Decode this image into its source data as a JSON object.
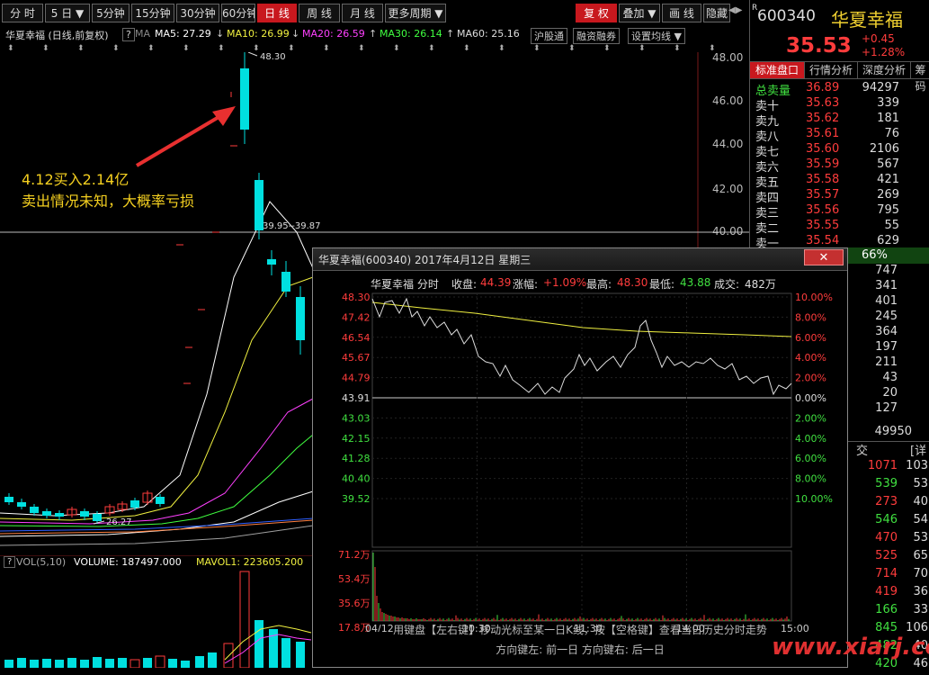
{
  "toolbar": {
    "buttons": [
      {
        "label": "分 时"
      },
      {
        "label": "5 日 ▼"
      },
      {
        "label": "5分钟"
      },
      {
        "label": "15分钟"
      },
      {
        "label": "30分钟"
      },
      {
        "label": "60分钟"
      },
      {
        "label": "日 线"
      },
      {
        "label": "周 线"
      },
      {
        "label": "月 线"
      },
      {
        "label": "更多周期 ▼"
      },
      {
        "label": "复 权"
      },
      {
        "label": "叠加 ▼"
      },
      {
        "label": "画 线"
      },
      {
        "label": "隐藏"
      }
    ],
    "active_index": 6
  },
  "chart_header": {
    "title": "华夏幸福 (日线,前复权)",
    "help": "?",
    "ma_label": "MA",
    "ma5": "MA5: 27.29",
    "ma10": "MA10: 26.99",
    "ma20": "MA20: 26.59",
    "ma30": "MA30: 26.14",
    "ma60": "MA60: 25.16",
    "tag1": "沪股通",
    "tag2": "融资融券",
    "tag3": "设置均线 ▼"
  },
  "colors": {
    "up": "#ff3c3c",
    "down": "#00e0e0",
    "ma5": "#ffffff",
    "ma10": "#f0f040",
    "ma20": "#ff40ff",
    "ma30": "#40ff40",
    "ma60": "#a0a0a0",
    "accent": "#c8181e"
  },
  "main_chart": {
    "y_ticks": [
      "48.00",
      "46.00",
      "44.00",
      "42.00",
      "40.00"
    ],
    "high_label": "48.30",
    "range_label": "39.95--39.87",
    "low_label": "26.27"
  },
  "annotation": {
    "line1": "4.12买入2.14亿",
    "line2": "卖出情况未知，大概率亏损"
  },
  "volume_header": {
    "vol": "VOL(5,10)",
    "volume": "VOLUME: 187497.000",
    "mavol1": "MAVOL1: 223605.200"
  },
  "right_panel": {
    "code": "600340",
    "name": "华夏幸福",
    "price": "35.53",
    "change": "+0.45",
    "change_pct": "+1.28%",
    "tabs": [
      "标准盘口",
      "行情分析",
      "深度分析",
      "筹码"
    ],
    "order_book": [
      {
        "label": "总卖量",
        "price": "36.89",
        "vol": "94297"
      },
      {
        "label": "卖十",
        "price": "35.63",
        "vol": "339"
      },
      {
        "label": "卖九",
        "price": "35.62",
        "vol": "181"
      },
      {
        "label": "卖八",
        "price": "35.61",
        "vol": "76"
      },
      {
        "label": "卖七",
        "price": "35.60",
        "vol": "2106"
      },
      {
        "label": "卖六",
        "price": "35.59",
        "vol": "567"
      },
      {
        "label": "卖五",
        "price": "35.58",
        "vol": "421"
      },
      {
        "label": "卖四",
        "price": "35.57",
        "vol": "269"
      },
      {
        "label": "卖三",
        "price": "35.56",
        "vol": "795"
      },
      {
        "label": "卖二",
        "price": "35.55",
        "vol": "55"
      },
      {
        "label": "卖一",
        "price": "35.54",
        "vol": "629"
      }
    ],
    "ratio": "66%",
    "side_values": [
      "747",
      "341",
      "401",
      "245",
      "364",
      "197",
      "211",
      "43",
      "20",
      "127"
    ],
    "total": "49950",
    "trade_header_left": "交",
    "trade_header_right": "[详",
    "trades": [
      {
        "a": "1071",
        "b": "103",
        "ca": "#ff3c3c"
      },
      {
        "a": "539",
        "b": "53",
        "ca": "#40e040"
      },
      {
        "a": "273",
        "b": "40",
        "ca": "#ff3c3c"
      },
      {
        "a": "546",
        "b": "54",
        "ca": "#40e040"
      },
      {
        "a": "470",
        "b": "53",
        "ca": "#ff3c3c"
      },
      {
        "a": "525",
        "b": "65",
        "ca": "#ff3c3c"
      },
      {
        "a": "714",
        "b": "70",
        "ca": "#ff3c3c"
      },
      {
        "a": "419",
        "b": "36",
        "ca": "#ff3c3c"
      },
      {
        "a": "166",
        "b": "33",
        "ca": "#40e040"
      },
      {
        "a": "845",
        "b": "106",
        "ca": "#40e040"
      },
      {
        "a": "482",
        "b": "40",
        "ca": "#40e040"
      },
      {
        "a": "420",
        "b": "46",
        "ca": "#40e040"
      }
    ]
  },
  "popup": {
    "title": "华夏幸福(600340) 2017年4月12日 星期三",
    "close": "✕",
    "info_name": "华夏幸福 分时",
    "close_label": "收盘:",
    "close_val": "44.39",
    "chg_label": "涨幅:",
    "chg_val": "+1.09%",
    "high_label": "最高:",
    "high_val": "48.30",
    "low_label": "最低:",
    "low_val": "43.88",
    "vol_label": "成交:",
    "vol_val": "482万",
    "price_ticks": [
      "48.30",
      "47.42",
      "46.54",
      "45.67",
      "44.79",
      "43.91",
      "43.03",
      "42.15",
      "41.28",
      "40.40",
      "39.52"
    ],
    "pct_ticks": [
      "10.00%",
      "8.00%",
      "6.00%",
      "4.00%",
      "2.00%",
      "0.00%",
      "2.00%",
      "4.00%",
      "6.00%",
      "8.00%",
      "10.00%"
    ],
    "vol_ticks": [
      "71.2万",
      "53.4万",
      "35.6万",
      "17.8万"
    ],
    "time_ticks": [
      "04/12",
      "10:30",
      "11:30",
      "14:00",
      "15:00"
    ],
    "hint1": "用键盘【左右键】移动光标至某一日K线，按【空格键】查看当日历史分时走势",
    "hint2": "方向键左: 前一日    方向键右: 后一日"
  },
  "watermark": "www.xiarj.com"
}
